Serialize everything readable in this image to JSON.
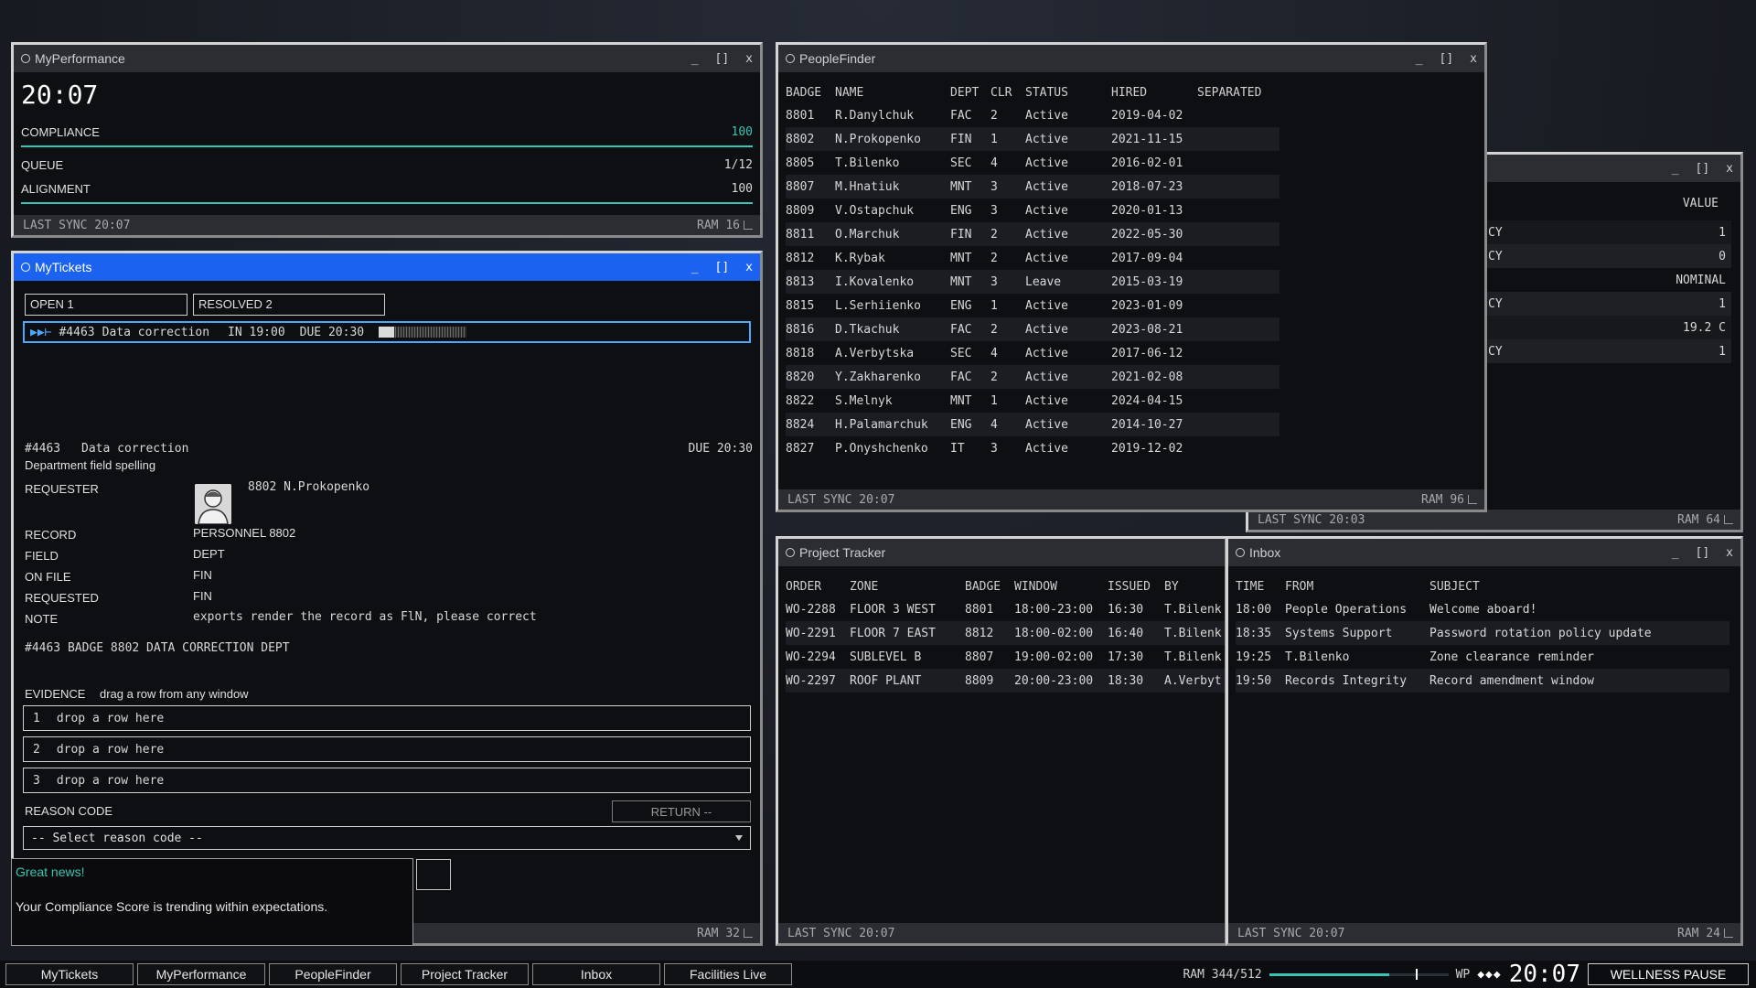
{
  "perf": {
    "title": "MyPerformance",
    "clock": "20:07",
    "compliance_label": "COMPLIANCE",
    "compliance_value": "100",
    "compliance_pct": 100,
    "queue_label": "QUEUE",
    "queue_value": "1/12",
    "alignment_label": "ALIGNMENT",
    "alignment_value": "100",
    "alignment_pct": 100,
    "sync": "LAST SYNC 20:07",
    "ram": "RAM 16"
  },
  "tickets": {
    "title": "MyTickets",
    "tab_open": "OPEN 1",
    "tab_resolved": "RESOLVED 2",
    "line": {
      "arrows": "▶▶⊢",
      "id": "#4463",
      "name": "Data correction",
      "in": "IN 19:00",
      "due": "DUE 20:30",
      "progress_pct": 18
    },
    "detail": {
      "id": "#4463",
      "name": "Data correction",
      "due": "DUE 20:30",
      "subtitle": "Department field spelling",
      "requester_label": "REQUESTER",
      "requester_value": "8802 N.Prokopenko",
      "record_label": "RECORD",
      "record_value": "PERSONNEL 8802",
      "field_label": "FIELD",
      "field_value": "DEPT",
      "onfile_label": "ON FILE",
      "onfile_value": "FIN",
      "requested_label": "REQUESTED",
      "requested_value": "FIN",
      "note_label": "NOTE",
      "note_value": "exports render the record as FlN, please correct",
      "summary": "#4463 BADGE 8802 DATA CORRECTION DEPT"
    },
    "evidence_label": "EVIDENCE",
    "evidence_hint": "drag a row from any window",
    "slots": [
      {
        "num": "1",
        "text": "drop a row here"
      },
      {
        "num": "2",
        "text": "drop a row here"
      },
      {
        "num": "3",
        "text": "drop a row here"
      }
    ],
    "reason_label": "REASON CODE",
    "return_label": "RETURN --",
    "select_value": "-- Select reason code --",
    "ram": "RAM 32"
  },
  "toast": {
    "headline": "Great news!",
    "body": "Your Compliance Score is trending within expectations."
  },
  "people": {
    "title": "PeopleFinder",
    "headers": [
      "BADGE",
      "NAME",
      "DEPT",
      "CLR",
      "STATUS",
      "HIRED",
      "SEPARATED"
    ],
    "rows": [
      [
        "8801",
        "R.Danylchuk",
        "FAC",
        "2",
        "Active",
        "2019-04-02",
        ""
      ],
      [
        "8802",
        "N.Prokopenko",
        "FIN",
        "1",
        "Active",
        "2021-11-15",
        ""
      ],
      [
        "8805",
        "T.Bilenko",
        "SEC",
        "4",
        "Active",
        "2016-02-01",
        ""
      ],
      [
        "8807",
        "M.Hnatiuk",
        "MNT",
        "3",
        "Active",
        "2018-07-23",
        ""
      ],
      [
        "8809",
        "V.Ostapchuk",
        "ENG",
        "3",
        "Active",
        "2020-01-13",
        ""
      ],
      [
        "8811",
        "O.Marchuk",
        "FIN",
        "2",
        "Active",
        "2022-05-30",
        ""
      ],
      [
        "8812",
        "K.Rybak",
        "MNT",
        "2",
        "Active",
        "2017-09-04",
        ""
      ],
      [
        "8813",
        "I.Kovalenko",
        "MNT",
        "3",
        "Leave",
        "2015-03-19",
        ""
      ],
      [
        "8815",
        "L.Serhiienko",
        "ENG",
        "1",
        "Active",
        "2023-01-09",
        ""
      ],
      [
        "8816",
        "D.Tkachuk",
        "FAC",
        "2",
        "Active",
        "2023-08-21",
        ""
      ],
      [
        "8818",
        "A.Verbytska",
        "SEC",
        "4",
        "Active",
        "2017-06-12",
        ""
      ],
      [
        "8820",
        "Y.Zakharenko",
        "FAC",
        "2",
        "Active",
        "2021-02-08",
        ""
      ],
      [
        "8822",
        "S.Melnyk",
        "MNT",
        "1",
        "Active",
        "2024-04-15",
        ""
      ],
      [
        "8824",
        "H.Palamarchuk",
        "ENG",
        "4",
        "Active",
        "2014-10-27",
        ""
      ],
      [
        "8827",
        "P.Onyshchenko",
        "IT",
        "3",
        "Active",
        "2019-12-02",
        ""
      ]
    ],
    "sync": "LAST SYNC 20:07",
    "ram": "RAM 96"
  },
  "facilities": {
    "value_header": "VALUE",
    "rows": [
      {
        "label": "CY",
        "value": "1"
      },
      {
        "label": "CY",
        "value": "0"
      },
      {
        "label": "",
        "value": "NOMINAL"
      },
      {
        "label": "CY",
        "value": "1"
      },
      {
        "label": "",
        "value": "19.2 C"
      },
      {
        "label": "CY",
        "value": "1"
      }
    ],
    "sync": "LAST SYNC 20:03",
    "ram": "RAM 64"
  },
  "projects": {
    "title": "Project Tracker",
    "headers": [
      "ORDER",
      "ZONE",
      "BADGE",
      "WINDOW",
      "ISSUED",
      "BY"
    ],
    "rows": [
      [
        "WO-2288",
        "FLOOR 3 WEST",
        "8801",
        "18:00-23:00",
        "16:30",
        "T.Bilenk"
      ],
      [
        "WO-2291",
        "FLOOR 7 EAST",
        "8812",
        "18:00-02:00",
        "16:40",
        "T.Bilenk"
      ],
      [
        "WO-2294",
        "SUBLEVEL B",
        "8807",
        "19:00-02:00",
        "17:30",
        "T.Bilenk"
      ],
      [
        "WO-2297",
        "ROOF PLANT",
        "8809",
        "20:00-23:00",
        "18:30",
        "A.Verbyt"
      ]
    ],
    "sync": "LAST SYNC 20:07"
  },
  "inbox": {
    "title": "Inbox",
    "headers": [
      "TIME",
      "FROM",
      "SUBJECT"
    ],
    "rows": [
      [
        "18:00",
        "People Operations",
        "Welcome aboard!"
      ],
      [
        "18:35",
        "Systems Support",
        "Password rotation policy update"
      ],
      [
        "19:25",
        "T.Bilenko",
        "Zone clearance reminder"
      ],
      [
        "19:50",
        "Records Integrity",
        "Record amendment window"
      ]
    ],
    "sync": "LAST SYNC 20:07",
    "ram": "RAM 24"
  },
  "taskbar": {
    "items": [
      "MyTickets",
      "MyPerformance",
      "PeopleFinder",
      "Project Tracker",
      "Inbox",
      "Facilities Live"
    ],
    "ram_label": "RAM 344/512",
    "ram_fraction": 0.672,
    "wp_label": "WP",
    "wp_diamonds": "◆◆◆",
    "clock": "20:07",
    "wellness": "WELLNESS PAUSE"
  },
  "colors": {
    "accent": "#1b62f0",
    "teal": "#38c4b4",
    "focus": "#4da6ff"
  },
  "ctrl": {
    "min": "_",
    "max": "[]",
    "close": "x"
  }
}
